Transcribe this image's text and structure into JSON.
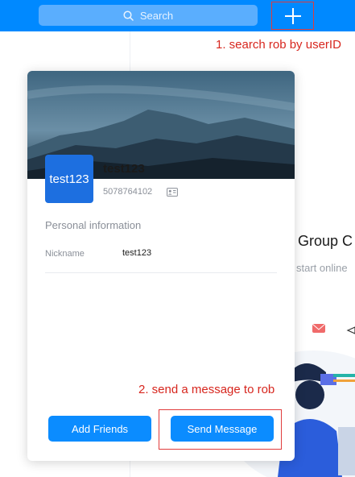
{
  "topbar": {
    "search_placeholder": "Search",
    "add_icon": "plus-icon",
    "accent": "#0089ff"
  },
  "annotations": {
    "step1": "1. search rob by userID",
    "step2": "2. send a message to rob",
    "color": "#d7261e"
  },
  "background": {
    "title": "Group C",
    "subtitle": "start online"
  },
  "profile": {
    "avatar_text": "test123",
    "name": "test123",
    "user_id": "5078764102",
    "section_title": "Personal information",
    "nickname_label": "Nickname",
    "nickname_value": "test123"
  },
  "actions": {
    "add_friends": "Add Friends",
    "send_message": "Send Message"
  }
}
